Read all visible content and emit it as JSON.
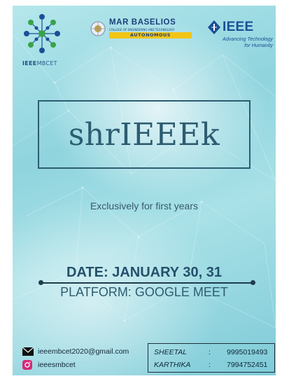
{
  "logos": {
    "ieee_mbcet": {
      "text_a": "IEEE",
      "text_b": "MBCET"
    },
    "college": {
      "name": "MAR BASELIOS",
      "subtitle": "COLLEGE OF ENGINEERING AND TECHNOLOGY",
      "badge": "AUTONOMOUS"
    },
    "ieee": {
      "word": "IEEE",
      "tagline_1": "Advancing Technology",
      "tagline_2": "for Humanity"
    }
  },
  "event": {
    "title": "shrIEEEk",
    "subtitle": "Exclusively for first years",
    "date": "DATE: JANUARY 30, 31",
    "platform": "PLATFORM: GOOGLE MEET"
  },
  "contact": {
    "email": "ieeembcet2020@gmail.com",
    "instagram": "ieeesmbcet",
    "coordinators": [
      {
        "name": "SHEETAL",
        "sep": ":",
        "phone": "9995019493"
      },
      {
        "name": "KARTHIKA",
        "sep": ":",
        "phone": "7994752451"
      }
    ]
  },
  "colors": {
    "accent": "#2d5c70",
    "ieee_blue": "#1a4f96",
    "badge": "#f2c415"
  },
  "icons": [
    "network-logo-icon",
    "college-emblem-icon",
    "ieee-diamond-icon",
    "mail-icon",
    "instagram-icon"
  ]
}
